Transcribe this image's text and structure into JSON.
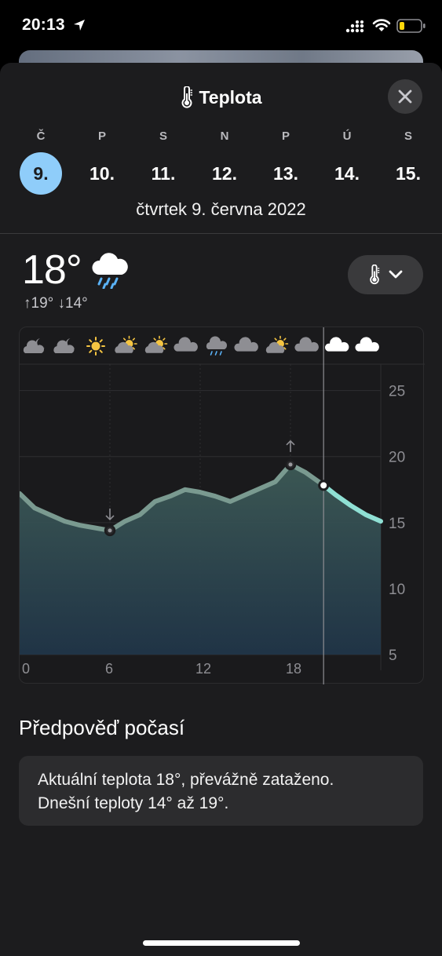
{
  "status_bar": {
    "time": "20:13"
  },
  "header": {
    "title": "Teplota",
    "close_label": "close"
  },
  "days": [
    {
      "letter": "Č",
      "num": "9.",
      "selected": true
    },
    {
      "letter": "P",
      "num": "10."
    },
    {
      "letter": "S",
      "num": "11."
    },
    {
      "letter": "N",
      "num": "12."
    },
    {
      "letter": "P",
      "num": "13."
    },
    {
      "letter": "Ú",
      "num": "14."
    },
    {
      "letter": "S",
      "num": "15."
    }
  ],
  "full_date": "čtvrtek 9. června 2022",
  "current": {
    "temp": "18°",
    "high": "↑19°",
    "low": "↓14°",
    "icon": "rain-cloud-icon"
  },
  "hour_icons": [
    "moon-cloud",
    "moon-cloud",
    "sun",
    "sun-cloud",
    "sun-cloud",
    "cloud",
    "rain-cloud",
    "cloud",
    "sun-cloud",
    "cloud",
    "cloud",
    "cloud"
  ],
  "chart_data": {
    "type": "area",
    "x": [
      0,
      1,
      2,
      3,
      4,
      5,
      6,
      7,
      8,
      9,
      10,
      11,
      12,
      13,
      14,
      15,
      16,
      17,
      18,
      19,
      20,
      21,
      22,
      23,
      24
    ],
    "y": [
      17.2,
      16.1,
      15.6,
      15.1,
      14.8,
      14.6,
      14.4,
      15.1,
      15.6,
      16.6,
      17.0,
      17.5,
      17.3,
      17.0,
      16.6,
      17.1,
      17.6,
      18.1,
      19.4,
      18.8,
      18.0,
      17.1,
      16.3,
      15.6,
      15.1
    ],
    "xticks": [
      "0",
      "6",
      "12",
      "18"
    ],
    "yticks": [
      "25",
      "20",
      "15",
      "10",
      "5"
    ],
    "ylim": [
      5,
      27
    ],
    "xlim": [
      0,
      24
    ],
    "now_hour": 20.2,
    "min_point": {
      "x": 6,
      "y": 14.4
    },
    "max_point": {
      "x": 18,
      "y": 19.4
    },
    "grid": true,
    "colors": {
      "past_line": "#7a9a90",
      "future_line": "#8fe0d4",
      "fill_top": "#3d5a56",
      "fill_bottom": "#203548"
    }
  },
  "forecast": {
    "title": "Předpověď počasí",
    "line1": "Aktuální teplota 18°, převážně zataženo.",
    "line2": "Dnešní teploty 14° až 19°."
  }
}
